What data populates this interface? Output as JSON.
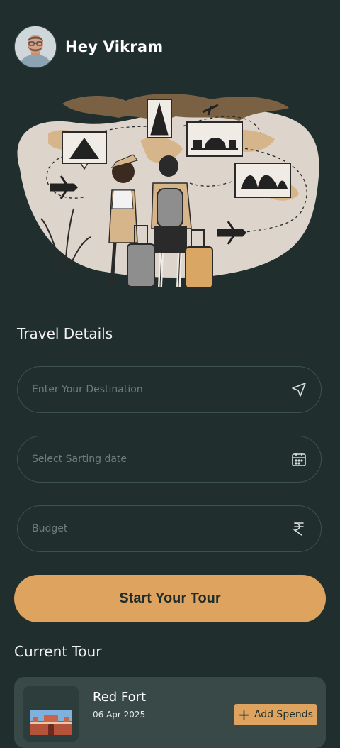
{
  "header": {
    "greeting": "Hey Vikram"
  },
  "travel": {
    "section_title": "Travel Details",
    "destination_placeholder": "Enter Your Destination",
    "date_placeholder": "Select Sarting date",
    "budget_placeholder": "Budget"
  },
  "actions": {
    "start_label": "Start Your Tour"
  },
  "current": {
    "section_title": "Current Tour",
    "tour_name": "Red Fort",
    "tour_date": "06 Apr 2025",
    "add_label": "Add Spends"
  },
  "icons": {
    "destination": "send-icon",
    "date": "calendar-icon",
    "budget": "rupee-icon",
    "add": "plus-icon"
  },
  "colors": {
    "background": "#202f2d",
    "accent": "#dda35f",
    "card": "#384947",
    "field_border": "#3d514e"
  }
}
